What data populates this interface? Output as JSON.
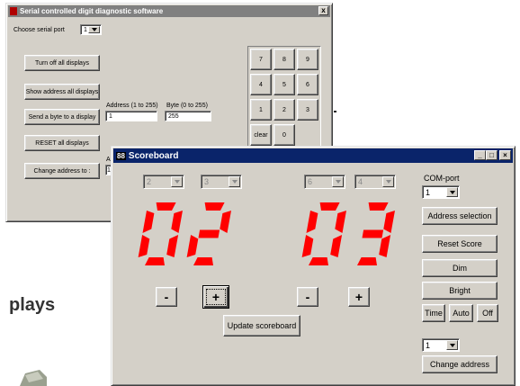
{
  "background": {
    "partial_title": "plays"
  },
  "diag": {
    "title": "Serial controlled digit diagnostic software",
    "close": "x",
    "serial_port_label": "Choose serial port",
    "serial_port_value": "1",
    "buttons": {
      "turn_off": "Turn off all displays",
      "show_address": "Show address all displays",
      "send_byte": "Send a byte to a display",
      "reset": "RESET all displays",
      "change_address": "Change address to :"
    },
    "address_label": "Address (1 to 255)",
    "address_value": "1",
    "byte_label": "Byte (0 to 255)",
    "byte_value": "255",
    "hidden_label_fragment": "Ac",
    "hidden_field_fragment": "1",
    "keypad": [
      "7",
      "8",
      "9",
      "4",
      "5",
      "6",
      "1",
      "2",
      "3",
      "clear",
      "0"
    ]
  },
  "score": {
    "title": "Scoreboard",
    "icon_text": "88",
    "controls": {
      "minimize": "_",
      "maximize": "□",
      "close": "×"
    },
    "left_selects": [
      "2",
      "3"
    ],
    "right_selects": [
      "6",
      "4"
    ],
    "left_score": "02",
    "right_score": "03",
    "digit_color": "#ff0000",
    "minus": "-",
    "plus": "+",
    "update": "Update scoreboard",
    "com_label": "COM-port",
    "com_value": "1",
    "address_selection": "Address selection",
    "reset_score": "Reset Score",
    "dim": "Dim",
    "bright": "Bright",
    "time": "Time",
    "auto": "Auto",
    "off": "Off",
    "address_value": "1",
    "change_address": "Change address"
  }
}
